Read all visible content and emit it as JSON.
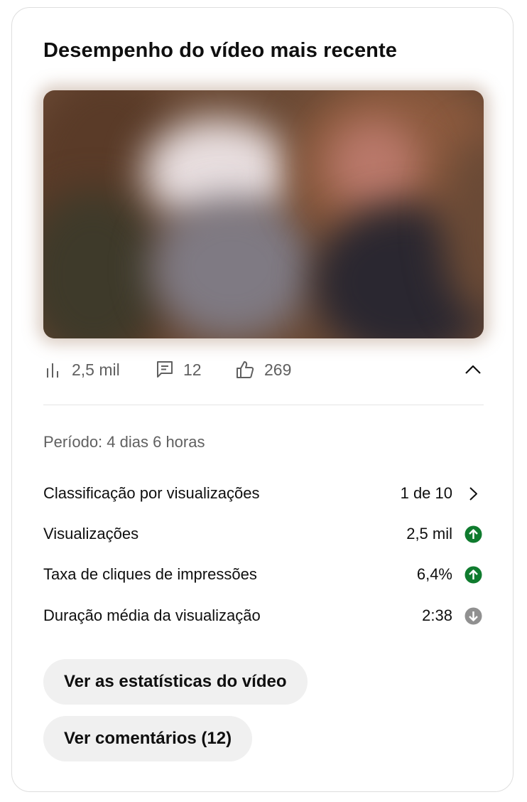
{
  "card": {
    "title": "Desempenho do vídeo mais recente"
  },
  "video": {
    "thumbnail": "blurred-video-thumbnail"
  },
  "stats": {
    "views": "2,5 mil",
    "comments": "12",
    "likes": "269"
  },
  "period": "Período: 4 dias 6 horas",
  "metrics": [
    {
      "label": "Classificação por visualizações",
      "value": "1 de 10",
      "indicator": "chevron-right"
    },
    {
      "label": "Visualizações",
      "value": "2,5 mil",
      "indicator": "arrow-up",
      "color": "#0f7b2e"
    },
    {
      "label": "Taxa de cliques de impressões",
      "value": "6,4%",
      "indicator": "arrow-up",
      "color": "#0f7b2e"
    },
    {
      "label": "Duração média da visualização",
      "value": "2:38",
      "indicator": "arrow-down",
      "color": "#909090"
    }
  ],
  "buttons": {
    "stats": "Ver as estatísticas do vídeo",
    "comments": "Ver comentários (12)"
  }
}
